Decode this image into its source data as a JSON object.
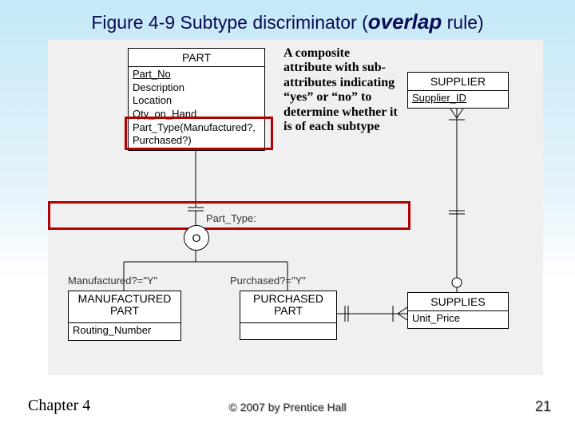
{
  "title_prefix": "Figure 4-9 Subtype discriminator (",
  "title_ital": "overlap",
  "title_suffix": " rule)",
  "annotation": "A composite attribute with sub-attributes indicating “yes” or “no” to determine whether it is of each subtype",
  "entities": {
    "part": {
      "name": "PART",
      "attrs": [
        "Part_No",
        "Description",
        "Location",
        "Qty_on_Hand",
        "Part_Type(Manufactured?,",
        "Purchased?)"
      ]
    },
    "supplier": {
      "name": "SUPPLIER",
      "attrs": [
        "Supplier_ID"
      ]
    },
    "mfg": {
      "name": "MANUFACTURED PART",
      "attrs": [
        "Routing_Number"
      ]
    },
    "purch": {
      "name": "PURCHASED PART",
      "attrs": []
    },
    "supplies": {
      "name": "SUPPLIES",
      "attrs": [
        "Unit_Price"
      ]
    }
  },
  "o_letter": "O",
  "discriminator_label": "Part_Type:",
  "branch_left": "Manufactured?=\"Y\"",
  "branch_right": "Purchased?=\"Y\"",
  "footer_chapter": "Chapter 4",
  "footer_copyright": "© 2007 by Prentice Hall",
  "footer_page": "21"
}
